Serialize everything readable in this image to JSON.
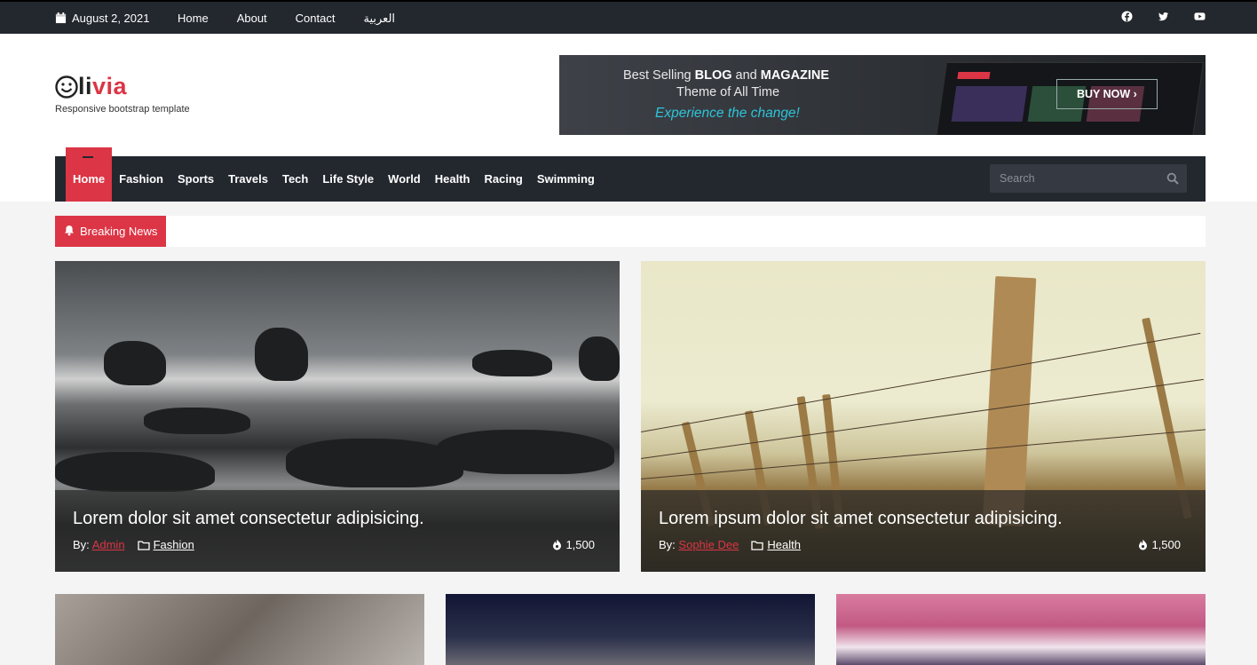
{
  "topbar": {
    "date": "August 2, 2021",
    "links": [
      "Home",
      "About",
      "Contact",
      "العربية"
    ],
    "social": [
      "facebook-icon",
      "twitter-icon",
      "youtube-icon"
    ]
  },
  "logo": {
    "prefix": "li",
    "accent": "via",
    "tagline": "Responsive bootstrap template"
  },
  "banner": {
    "line1_pre": "Best Selling ",
    "line1_b1": "BLOG",
    "line1_mid": " and ",
    "line1_b2": "MAGAZINE",
    "line2": "Theme of All Time",
    "line3": "Experience the change!",
    "button": "BUY NOW"
  },
  "nav": {
    "items": [
      "Home",
      "Fashion",
      "Sports",
      "Travels",
      "Tech",
      "Life Style",
      "World",
      "Health",
      "Racing",
      "Swimming"
    ],
    "search_placeholder": "Search"
  },
  "breaking": {
    "label": "Breaking News"
  },
  "featured": [
    {
      "title": "Lorem dolor sit amet consectetur adipisicing.",
      "by": "By:",
      "author": "Admin",
      "category": "Fashion",
      "views": "1,500"
    },
    {
      "title": "Lorem ipsum dolor sit amet consectetur adipisicing.",
      "by": "By:",
      "author": "Sophie Dee",
      "category": "Health",
      "views": "1,500"
    }
  ],
  "colors": {
    "accent": "#dc3545",
    "dark": "#23272e"
  }
}
